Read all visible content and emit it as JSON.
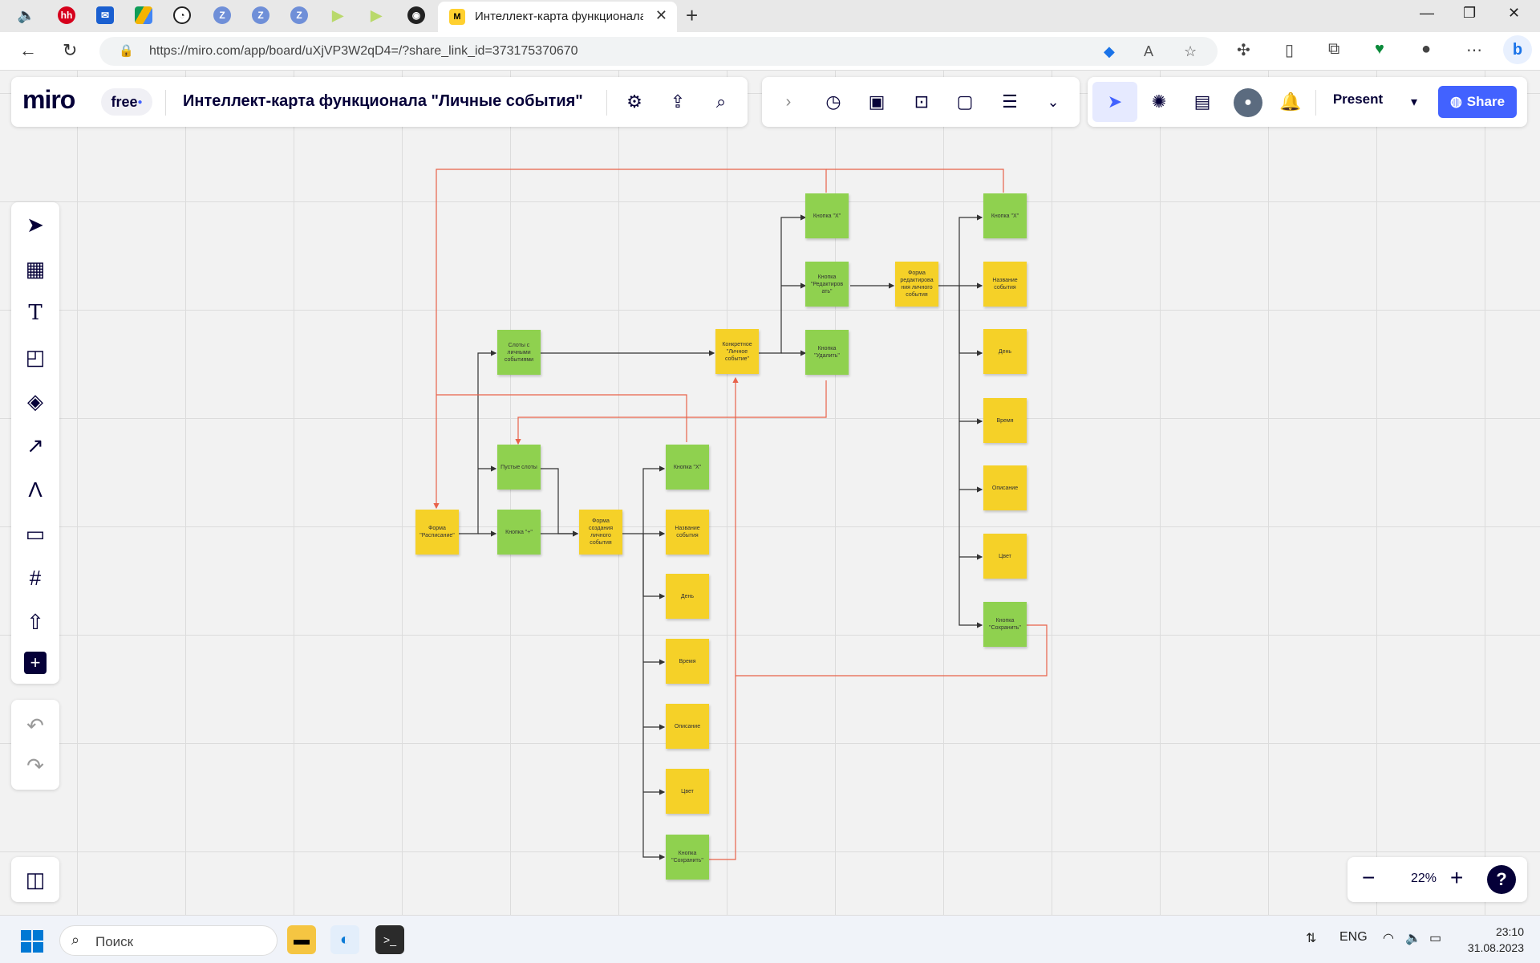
{
  "browser": {
    "tab_title": "Интеллект-карта функционала",
    "url": "https://miro.com/app/board/uXjVP3W2qD4=/?share_link_id=373175370670"
  },
  "miro": {
    "logo": "miro",
    "plan": "free",
    "board_title": "Интеллект-карта функционала \"Личные события\"",
    "present_label": "Present",
    "share_label": "Share",
    "zoom": "22%",
    "help": "?"
  },
  "board": {
    "notes": [
      {
        "id": "form-schedule",
        "text": "Форма \"Расписание\"",
        "color": "yellow"
      },
      {
        "id": "slots-with-events",
        "text": "Слоты с личными событиями",
        "color": "green"
      },
      {
        "id": "empty-slots",
        "text": "Пустые слоты",
        "color": "green"
      },
      {
        "id": "button-plus",
        "text": "Кнопка \"+\"",
        "color": "green"
      },
      {
        "id": "form-create",
        "text": "Форма создания личного события",
        "color": "yellow"
      },
      {
        "id": "create-x",
        "text": "Кнопка \"Х\"",
        "color": "green"
      },
      {
        "id": "create-name",
        "text": "Название события",
        "color": "yellow"
      },
      {
        "id": "create-day",
        "text": "День",
        "color": "yellow"
      },
      {
        "id": "create-time",
        "text": "Время",
        "color": "yellow"
      },
      {
        "id": "create-desc",
        "text": "Описание",
        "color": "yellow"
      },
      {
        "id": "create-color",
        "text": "Цвет",
        "color": "yellow"
      },
      {
        "id": "create-save",
        "text": "Кнопка \"Сохранить\"",
        "color": "green"
      },
      {
        "id": "concrete-event",
        "text": "Конкретное \"Личное событие\"",
        "color": "yellow"
      },
      {
        "id": "event-x",
        "text": "Кнопка \"Х\"",
        "color": "green"
      },
      {
        "id": "event-edit",
        "text": "Кнопка \"Редактиров ать\"",
        "color": "green"
      },
      {
        "id": "event-delete",
        "text": "Кнопка \"Удалить\"",
        "color": "green"
      },
      {
        "id": "form-edit",
        "text": "Форма редактирова ния личного события",
        "color": "yellow"
      },
      {
        "id": "edit-x",
        "text": "Кнопка \"Х\"",
        "color": "green"
      },
      {
        "id": "edit-name",
        "text": "Название события",
        "color": "yellow"
      },
      {
        "id": "edit-day",
        "text": "День",
        "color": "yellow"
      },
      {
        "id": "edit-time",
        "text": "Время",
        "color": "yellow"
      },
      {
        "id": "edit-desc",
        "text": "Описание",
        "color": "yellow"
      },
      {
        "id": "edit-color",
        "text": "Цвет",
        "color": "yellow"
      },
      {
        "id": "edit-save",
        "text": "Кнопка \"Сохранить\"",
        "color": "green"
      }
    ]
  },
  "taskbar": {
    "search_placeholder": "Поиск",
    "lang": "ENG",
    "time": "23:10",
    "date": "31.08.2023"
  },
  "colors": {
    "sticky_yellow": "#f5d128",
    "sticky_green": "#8fd14f",
    "connector_black": "#333333",
    "connector_red": "#e8624a",
    "accent": "#4262ff"
  }
}
